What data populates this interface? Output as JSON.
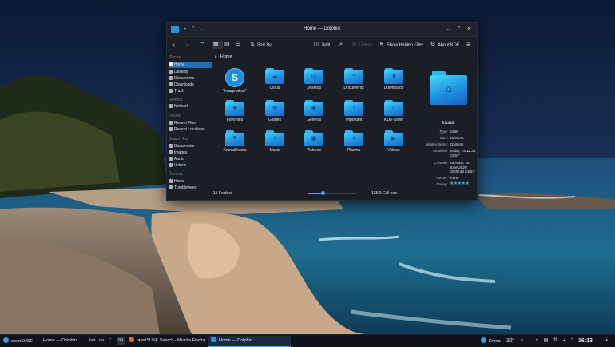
{
  "window": {
    "title": "Home — Dolphin",
    "toolbar": {
      "back": "‹",
      "forward": "›",
      "up": "⌃",
      "sort_label": "Sort By",
      "split_label": "Split",
      "delete_label": "Delete",
      "show_hidden_label": "Show Hidden Files",
      "about_label": "About KDE",
      "menu": "≡"
    }
  },
  "sidebar": {
    "places_header": "Places",
    "places": [
      "Home",
      "Desktop",
      "Documents",
      "Downloads",
      "Trash"
    ],
    "remote_header": "Remote",
    "remote": [
      "Network"
    ],
    "recent_header": "Recent",
    "recent": [
      "Recent Files",
      "Recent Locations"
    ],
    "search_header": "Search For",
    "search": [
      "Documents",
      "Images",
      "Audio",
      "Videos"
    ],
    "devices_header": "Devices",
    "devices": [
      "Home",
      "Tumbleweed"
    ]
  },
  "breadcrumb": {
    "arrow": "▸",
    "location": "Home"
  },
  "files": [
    {
      "name": "\"Imagination\"",
      "icon": "logo"
    },
    {
      "name": "Cloud",
      "icon": "cloud-icon",
      "glyph": "☁"
    },
    {
      "name": "Desktop",
      "icon": "desktop-icon",
      "glyph": "▭"
    },
    {
      "name": "Documents",
      "icon": "documents-icon",
      "glyph": "≡"
    },
    {
      "name": "Downloads",
      "icon": "downloads-icon",
      "glyph": "⬇"
    },
    {
      "name": "Favorites",
      "icon": "favorites-icon",
      "glyph": "★"
    },
    {
      "name": "Games",
      "icon": "games-icon",
      "glyph": "✜"
    },
    {
      "name": "General",
      "icon": "general-icon",
      "glyph": "◉"
    },
    {
      "name": "Important",
      "icon": "important-icon",
      "glyph": "!"
    },
    {
      "name": "KDE-Store",
      "icon": "kde-store-icon",
      "glyph": "⌂"
    },
    {
      "name": "Kruna&Ivana",
      "icon": "kruna-ivana-icon",
      "glyph": "♥"
    },
    {
      "name": "Music",
      "icon": "music-icon",
      "glyph": "♪"
    },
    {
      "name": "Pictures",
      "icon": "pictures-icon",
      "glyph": "▣"
    },
    {
      "name": "Plasma",
      "icon": "plasma-icon",
      "glyph": "✦"
    },
    {
      "name": "Videos",
      "icon": "videos-icon",
      "glyph": "▶"
    }
  ],
  "status": {
    "folders": "15 Folders",
    "zoom_fraction": 0.3,
    "free": "125.9 GiB free"
  },
  "info": {
    "name": "kruna",
    "rows": [
      {
        "k": "Type:",
        "v": "folder"
      },
      {
        "k": "Size:",
        "v": "15 items"
      },
      {
        "k": "Hidden items:",
        "v": "21 items"
      },
      {
        "k": "Modified:",
        "v": "Today, 15:12:34 CEST"
      },
      {
        "k": "Created:",
        "v": "Tuesday, 16 June 2020 02:00:44 CEST"
      },
      {
        "k": "Owner:",
        "v": "kruna"
      },
      {
        "k": "Rating:",
        "v": ""
      }
    ],
    "rating_stars": 5,
    "stars": "★★★★★"
  },
  "taskbar": {
    "start_label": "openSUSE",
    "tasks": [
      {
        "label": "Home — Dolphin"
      },
      {
        "label": "openSUSE Search - Mozilla Firefox"
      },
      {
        "label": "Home — Dolphin"
      }
    ],
    "pager": [
      "Iva",
      "na"
    ],
    "badge": "99",
    "user": "Kruna",
    "temperature": "32°",
    "clock": "16:13"
  },
  "colors": {
    "accent": "#3aa6e8",
    "folder": "#1f8fe0",
    "window_bg": "#1b1e24"
  }
}
